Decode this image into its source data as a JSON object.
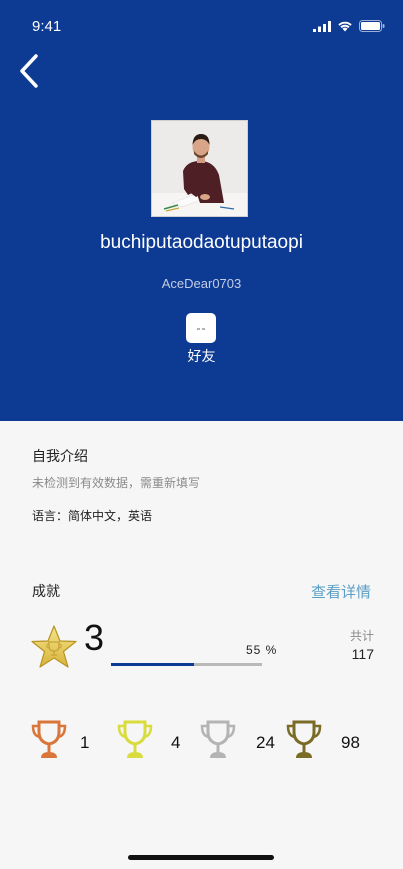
{
  "status_bar": {
    "time": "9:41"
  },
  "profile": {
    "username": "buchiputaodaotuputaopi",
    "user_id": "AceDear0703",
    "friend_label": "好友"
  },
  "intro": {
    "title": "自我介绍",
    "text": "未检测到有效数据，需重新填写",
    "languages": "语言：简体中文，英语"
  },
  "achievements": {
    "title": "成就",
    "detail_link": "查看详情",
    "level": "3",
    "progress_text": "55 %",
    "progress_fraction": 0.55,
    "total_label": "共计",
    "total_value": "117",
    "trophies": [
      {
        "icon": "bronze-trophy-icon",
        "color": "#d9763a",
        "count": "1"
      },
      {
        "icon": "yellow-trophy-icon",
        "color": "#d8dc3c",
        "count": "4"
      },
      {
        "icon": "silver-trophy-icon",
        "color": "#b4b4b4",
        "count": "24"
      },
      {
        "icon": "olive-trophy-icon",
        "color": "#7a6b25",
        "count": "98"
      }
    ]
  },
  "colors": {
    "header_bg": "#0d3a93",
    "link": "#5a9ec6",
    "background": "#f6f6f6"
  }
}
